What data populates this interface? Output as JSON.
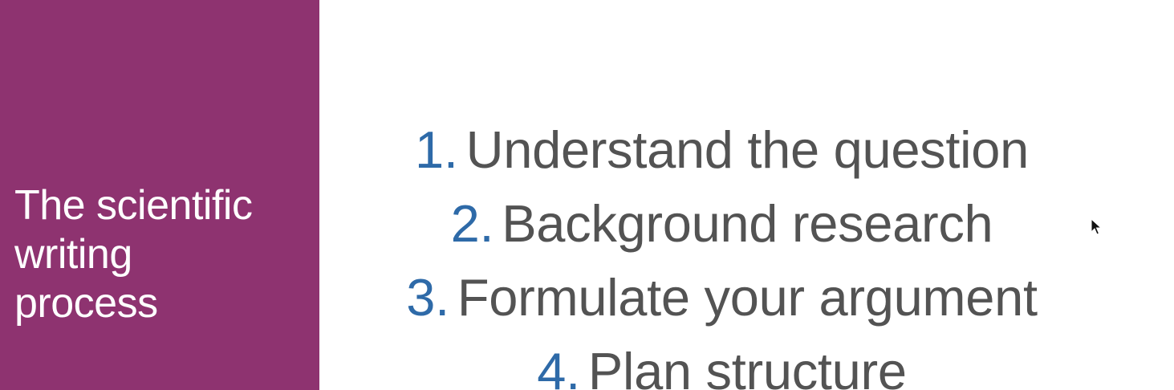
{
  "sidebar": {
    "title_line1": "The scientific",
    "title_line2": "writing",
    "title_line3": "process",
    "background_color": "#8e3370"
  },
  "steps": [
    {
      "number": "1.",
      "text": "Understand the question"
    },
    {
      "number": "2.",
      "text": "Background research"
    },
    {
      "number": "3.",
      "text": "Formulate your argument"
    },
    {
      "number": "4.",
      "text": "Plan structure"
    }
  ],
  "colors": {
    "number": "#2e6aa8",
    "text": "#535353"
  },
  "cursor": {
    "icon": "mouse-pointer-icon"
  }
}
